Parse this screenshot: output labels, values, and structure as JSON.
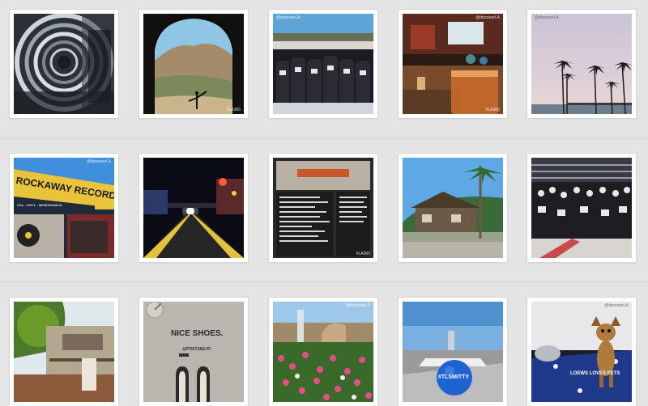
{
  "gallery": {
    "watermark": "@discoverLA",
    "hashtag": "#LA365",
    "photos": [
      {
        "subject": "spiral staircase"
      },
      {
        "subject": "cave arch overlooking beach with yoga pose"
      },
      {
        "subject": "hockey team at stadium"
      },
      {
        "subject": "bar with drink and tv screen"
      },
      {
        "subject": "palm trees and pier at dusk"
      },
      {
        "subject": "rockaway records storefront",
        "sign_text": "ROCKAWAY RECORDS",
        "sub_text": "CDs - VINYL - MEMORABILIA"
      },
      {
        "subject": "road with yellow lines at night"
      },
      {
        "subject": "chalkboard menu"
      },
      {
        "subject": "craftsman house with palm tree"
      },
      {
        "subject": "hockey team celebration on ice"
      },
      {
        "subject": "garden courtyard"
      },
      {
        "subject": "feet on sidewalk",
        "sidewalk_text": "NICE SHOES.",
        "sub_text": "@POSTSEEJO"
      },
      {
        "subject": "fountain and flower garden"
      },
      {
        "subject": "balloon on helipad",
        "balloon_text": "#TLSMITTY"
      },
      {
        "subject": "chihuahua on pet bed",
        "bed_text": "LOEWS LOVES PETS"
      }
    ]
  }
}
